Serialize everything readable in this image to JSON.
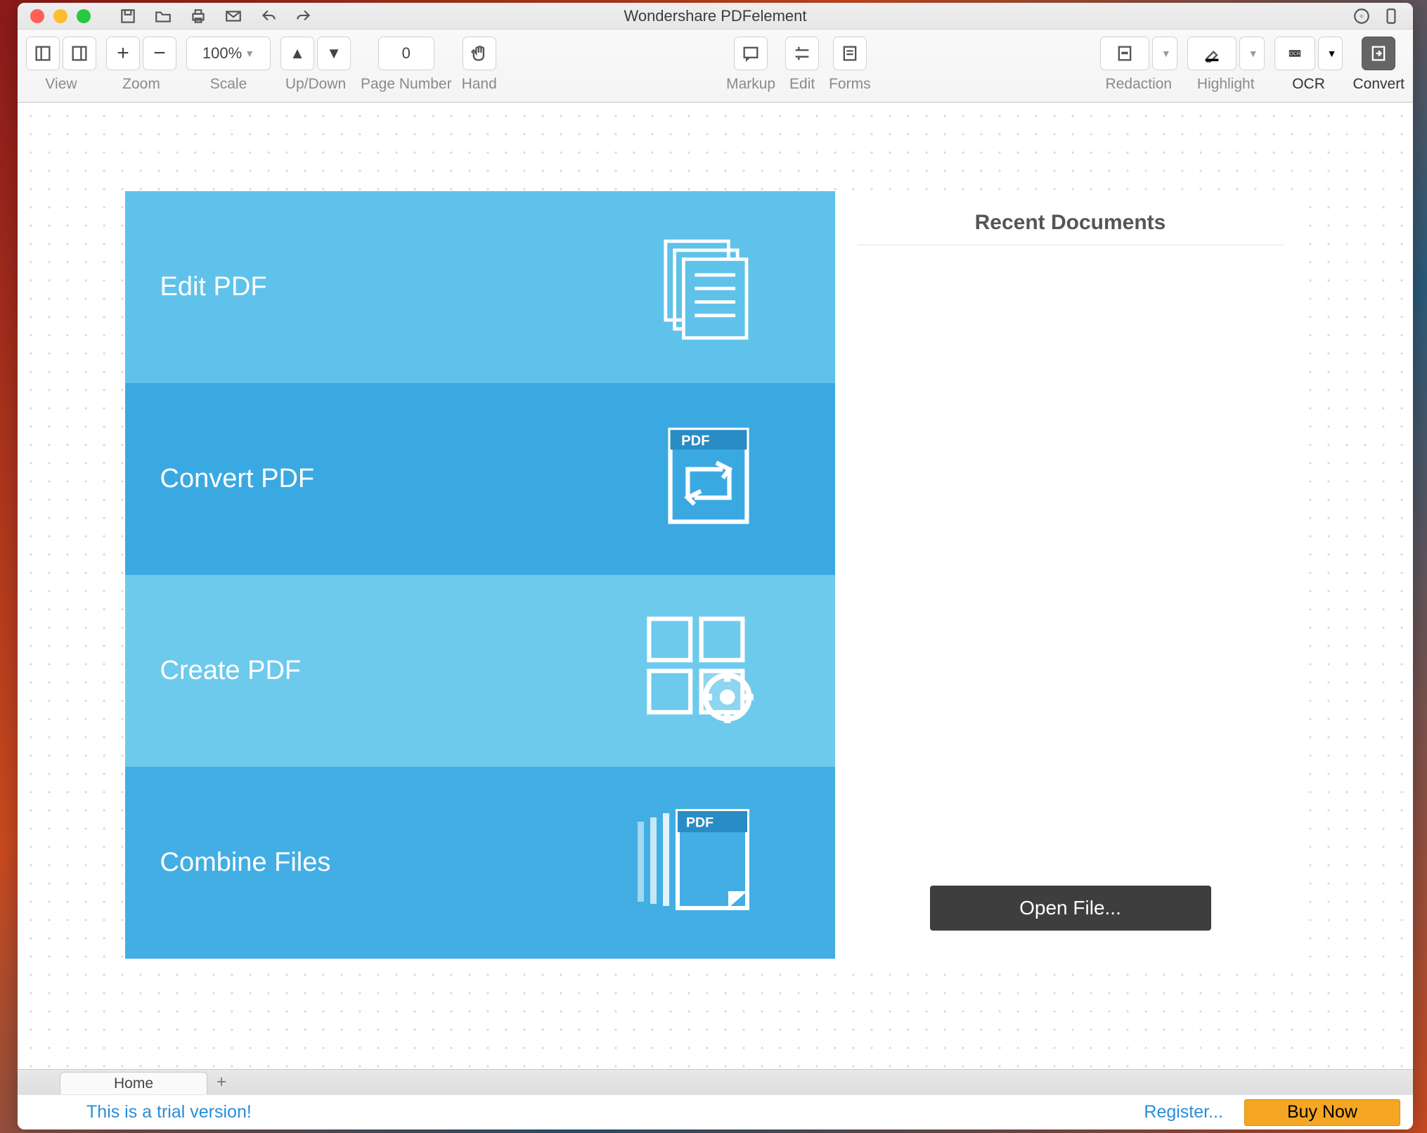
{
  "window": {
    "title": "Wondershare PDFelement"
  },
  "toolbar": {
    "view": "View",
    "zoom": "Zoom",
    "scale_value": "100%",
    "scale": "Scale",
    "updown": "Up/Down",
    "page_value": "0",
    "page": "Page Number",
    "hand": "Hand",
    "markup": "Markup",
    "edit": "Edit",
    "forms": "Forms",
    "redaction": "Redaction",
    "highlight": "Highlight",
    "ocr": "OCR",
    "convert": "Convert"
  },
  "start": {
    "edit": "Edit PDF",
    "convert": "Convert PDF",
    "create": "Create PDF",
    "combine": "Combine Files",
    "recent_title": "Recent Documents",
    "open_file": "Open File...",
    "convert_badge": "PDF",
    "combine_badge": "PDF"
  },
  "tabs": {
    "home": "Home"
  },
  "bottom": {
    "trial": "This is a trial version!",
    "register": "Register...",
    "buy": "Buy Now"
  }
}
